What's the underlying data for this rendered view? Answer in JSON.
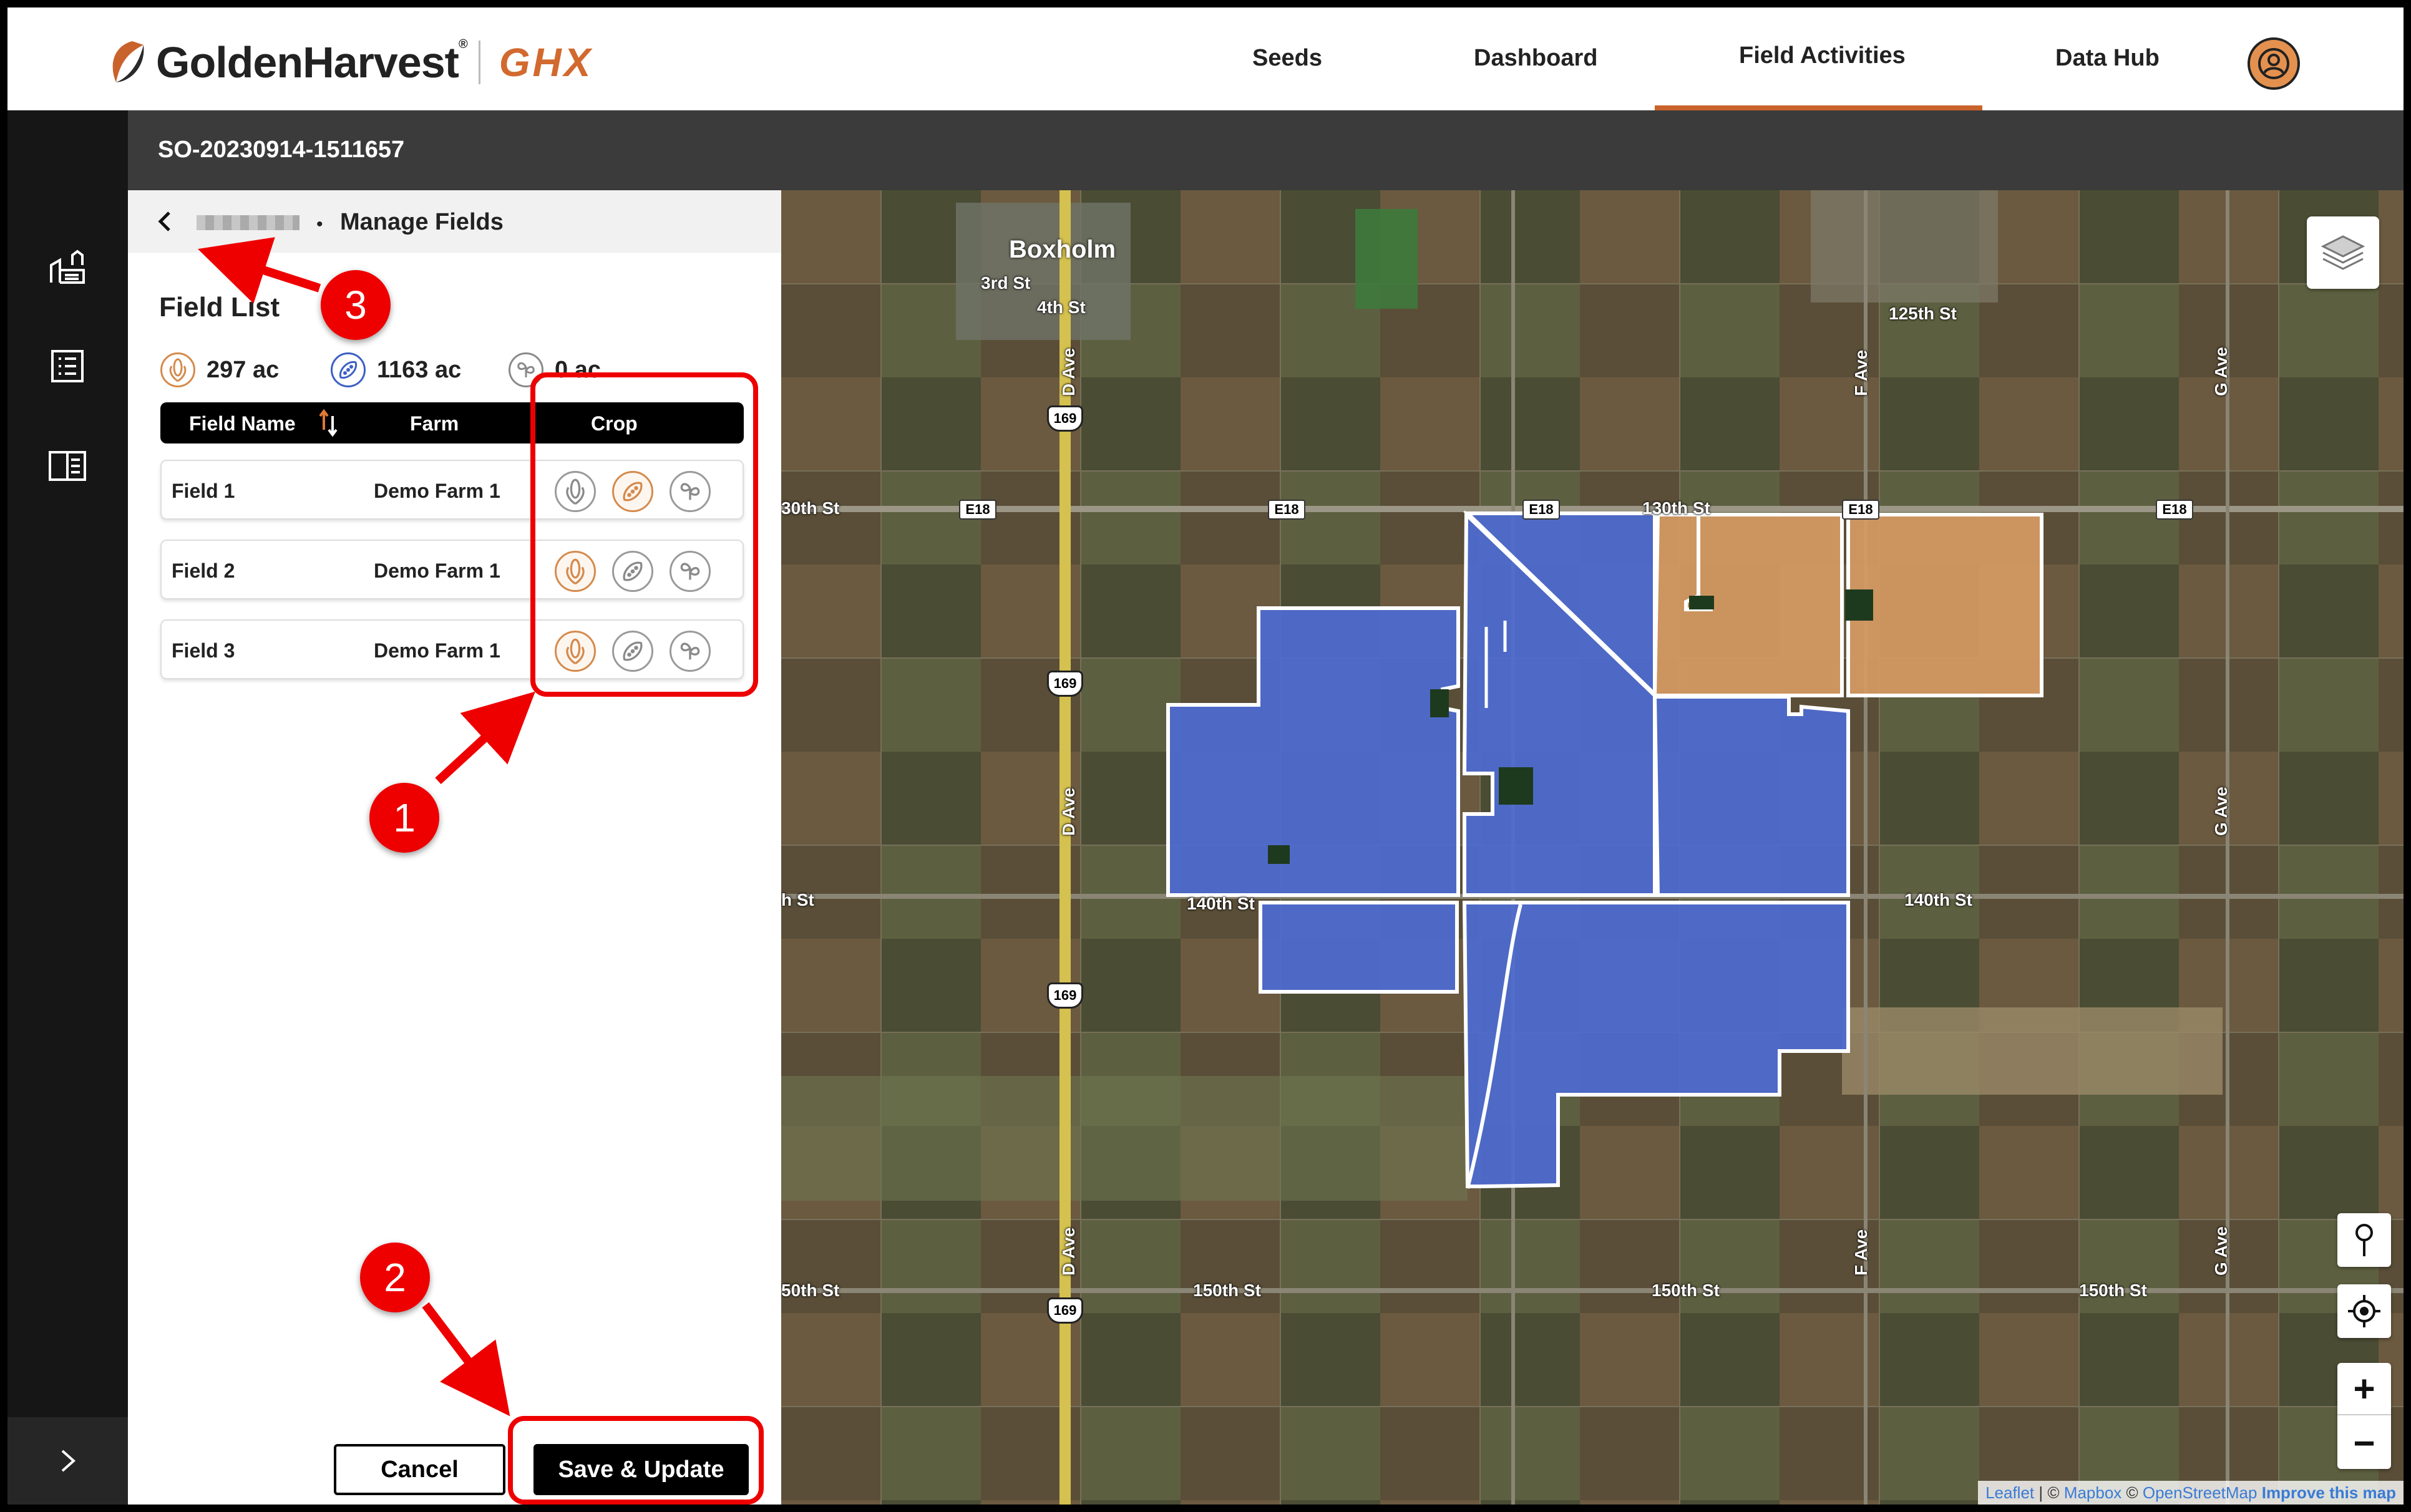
{
  "nav": {
    "brand": "GoldenHarvest",
    "brand_mark": "®",
    "product": "GHX",
    "items": [
      "Seeds",
      "Dashboard",
      "Field Activities",
      "Data Hub"
    ],
    "active": "Field Activities"
  },
  "order": {
    "id": "SO-20230914-1511657"
  },
  "panel": {
    "breadcrumb_separator": "•",
    "breadcrumb_title": "Manage Fields",
    "field_list_title": "Field List",
    "summary": [
      {
        "icon": "corn-icon",
        "value": "297 ac",
        "color": "#d58a4c"
      },
      {
        "icon": "soybean-icon",
        "value": "1163 ac",
        "color": "#3b5fc4"
      },
      {
        "icon": "other-crop-icon",
        "value": "0 ac",
        "color": "#8a8a8a"
      }
    ],
    "table": {
      "headers": {
        "name": "Field Name",
        "farm": "Farm",
        "crop": "Crop"
      },
      "rows": [
        {
          "name": "Field 1",
          "farm": "Demo Farm 1",
          "selected_crop": "soybean"
        },
        {
          "name": "Field 2",
          "farm": "Demo Farm 1",
          "selected_crop": "corn"
        },
        {
          "name": "Field 3",
          "farm": "Demo Farm 1",
          "selected_crop": "corn"
        }
      ]
    },
    "buttons": {
      "cancel": "Cancel",
      "save": "Save & Update"
    }
  },
  "map": {
    "town": "Boxholm",
    "labels": {
      "street_3rd": "3rd St",
      "street_4th": "4th St",
      "street_125th": "125th St",
      "street_130th": "130th St",
      "street_130th_left": "30th St",
      "street_140th": "140th St",
      "street_140th_left": "h St",
      "street_140th_mid": "140th St",
      "street_150th_left": "50th St",
      "street_150th_a": "150th St",
      "street_150th_b": "150th St",
      "street_150th_c": "150th St",
      "ave_d": "D Ave",
      "ave_f": "F Ave",
      "ave_g": "G Ave"
    },
    "highway": "169",
    "county_road": "E18",
    "colors": {
      "soybean_field": "#4d6bd1",
      "corn_field": "#d69a63",
      "boundary": "#ffffff"
    },
    "attribution": {
      "leaflet": "Leaflet",
      "sep": "|",
      "copy1": "©",
      "mapbox": "Mapbox",
      "copy2": "©",
      "osm": "OpenStreetMap",
      "improve": "Improve this map"
    },
    "zoom_in": "+",
    "zoom_out": "−"
  },
  "annotations": {
    "one": "1",
    "two": "2",
    "three": "3"
  }
}
